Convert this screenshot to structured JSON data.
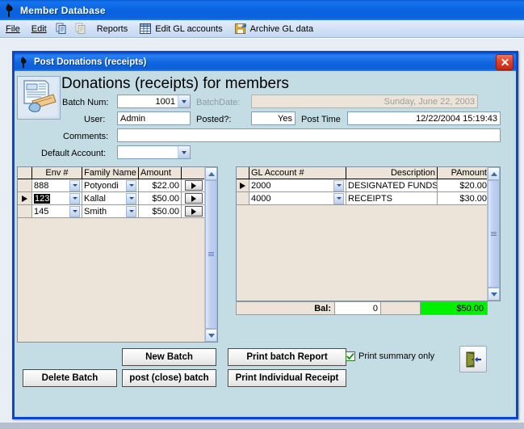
{
  "main_window": {
    "title": "Member Database",
    "icon": "app-flame-icon",
    "menu": [
      {
        "label": "File",
        "icon": null
      },
      {
        "label": "Edit",
        "icon": null
      },
      {
        "label": "",
        "icon": "copy-icon"
      },
      {
        "label": "",
        "icon": "paste-icon-disabled"
      },
      {
        "label": "Reports",
        "icon": null
      },
      {
        "label": "Edit GL accounts",
        "icon": "table-grid-icon"
      },
      {
        "label": "Archive GL data",
        "icon": "floppy-save-icon"
      }
    ]
  },
  "dialog": {
    "title": "Post Donations (receipts)",
    "title_icon": "app-flame-icon",
    "close_label": "X",
    "header": {
      "icon": "document-form-icon",
      "heading": "Donations (receipts) for members"
    },
    "fields": {
      "batch_num_label": "Batch Num:",
      "batch_num_value": "1001",
      "batch_date_label": "BatchDate:",
      "batch_date_value": "Sunday, June 22, 2003",
      "user_label": "User:",
      "user_value": "Admin",
      "posted_label": "Posted?:",
      "posted_value": "Yes",
      "post_time_label": "Post Time",
      "post_time_value": "12/22/2004 15:19:43",
      "comments_label": "Comments:",
      "comments_value": "",
      "default_account_label": "Default Account:",
      "default_account_value": ""
    },
    "left_grid": {
      "columns": [
        "",
        "Env #",
        "Family Name",
        "Amount",
        ""
      ],
      "rows": [
        {
          "marker": "",
          "env": "888",
          "family": "Potyondi",
          "amount": "$22.00",
          "selected": false
        },
        {
          "marker": "▶",
          "env": "123",
          "family": "Kallal",
          "amount": "$50.00",
          "selected": true
        },
        {
          "marker": "",
          "env": "145",
          "family": "Smith",
          "amount": "$50.00",
          "selected": false
        }
      ]
    },
    "right_grid": {
      "columns": [
        "",
        "GL Account #",
        "Description",
        "PAmount"
      ],
      "rows": [
        {
          "marker": "▶",
          "account": "2000",
          "description": "DESIGNATED FUNDS",
          "pamount": "$20.00"
        },
        {
          "marker": "",
          "account": "4000",
          "description": "RECEIPTS",
          "pamount": "$30.00"
        }
      ],
      "balance": {
        "label": "Bal:",
        "value": "0",
        "total": "$50.00",
        "total_color": "#00f000"
      }
    },
    "buttons": {
      "new_batch": "New Batch",
      "delete_batch": "Delete Batch",
      "post_close_batch": "post (close) batch",
      "print_batch_report": "Print batch Report",
      "print_individual_receipt": "Print Individual Receipt",
      "exit_icon": "exit-door-icon"
    },
    "checkbox": {
      "label": "Print summary only",
      "checked": true
    }
  }
}
